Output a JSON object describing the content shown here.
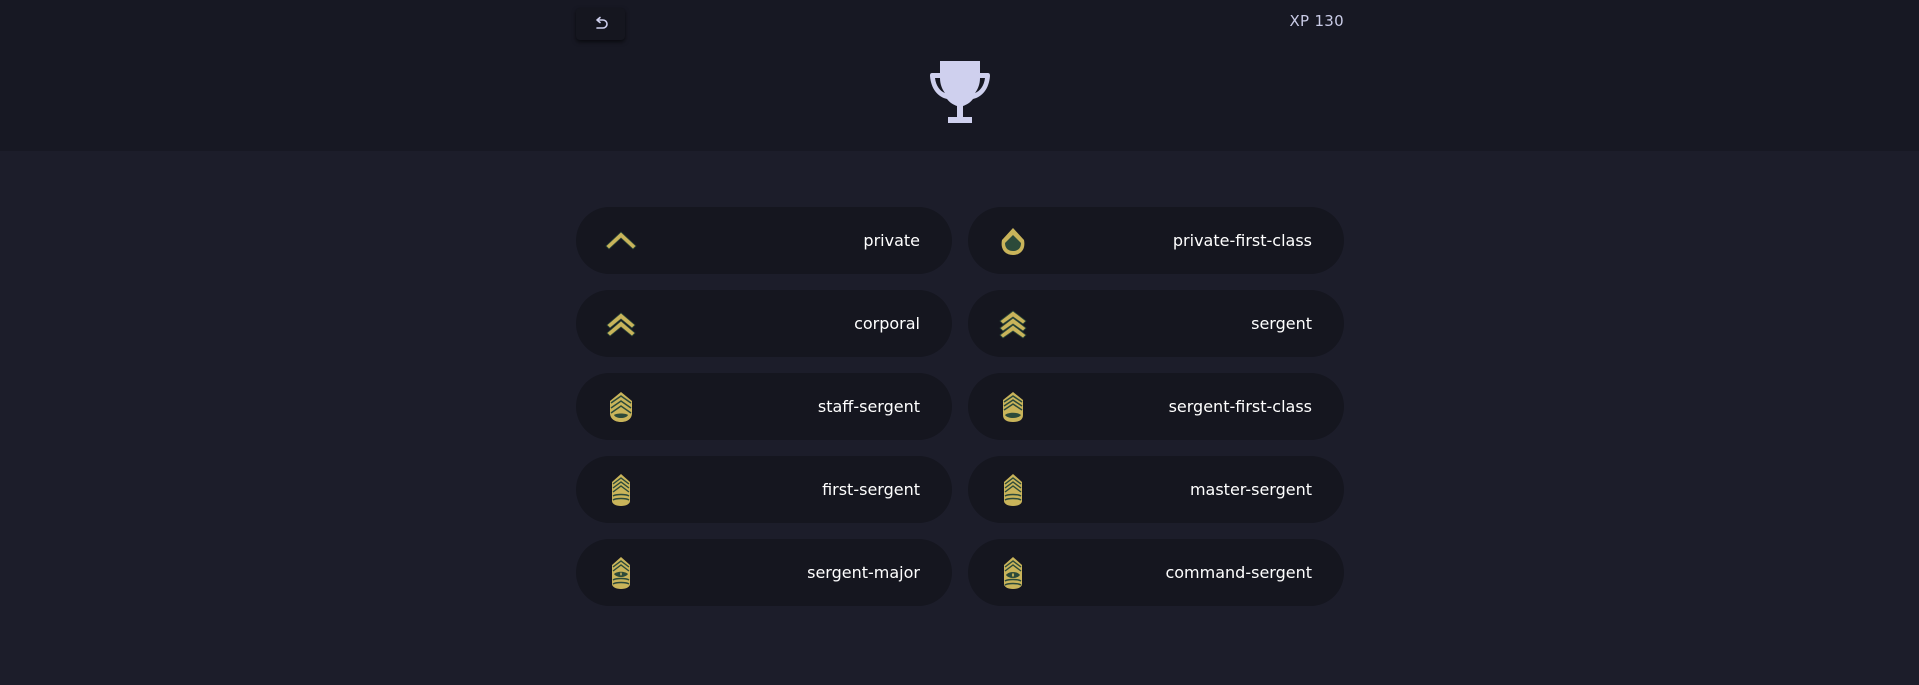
{
  "header": {
    "back_icon": "undo-arrow-icon",
    "xp_label": "XP 130",
    "trophy_icon": "trophy-icon",
    "icon_color": "#cfd0ee"
  },
  "colors": {
    "background": "#1c1d2a",
    "header_background": "#171823",
    "card_background": "#15161f",
    "insignia_gold": "#c9b45a",
    "insignia_green": "#2c4a3a"
  },
  "ranks": [
    {
      "label": "private",
      "icon": "private-insignia-icon"
    },
    {
      "label": "private-first-class",
      "icon": "private-first-class-insignia-icon"
    },
    {
      "label": "corporal",
      "icon": "corporal-insignia-icon"
    },
    {
      "label": "sergent",
      "icon": "sergeant-insignia-icon"
    },
    {
      "label": "staff-sergent",
      "icon": "staff-sergeant-insignia-icon"
    },
    {
      "label": "sergent-first-class",
      "icon": "sergeant-first-class-insignia-icon"
    },
    {
      "label": "first-sergent",
      "icon": "first-sergeant-insignia-icon"
    },
    {
      "label": "master-sergent",
      "icon": "master-sergeant-insignia-icon"
    },
    {
      "label": "sergent-major",
      "icon": "sergeant-major-insignia-icon"
    },
    {
      "label": "command-sergent",
      "icon": "command-sergeant-insignia-icon"
    }
  ]
}
